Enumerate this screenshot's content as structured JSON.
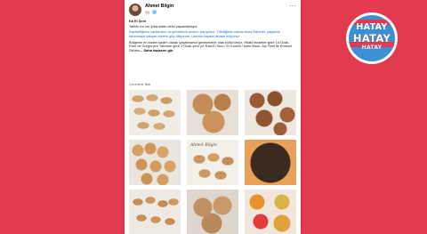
{
  "post": {
    "author": "Ahmet Bilgin",
    "time": "1g",
    "globe_icon": "globe-icon",
    "more_icon": "more-options-icon",
    "title": "Kâ El Şeni",
    "paragraphs": [
      "Tarihin en zor yıllarından birini yaşamaktayız.",
      "Kaybettiğimiz canlarımız ve şehrimizin acısını yaşıyoruz. Yitirdiğimiz canlarımıza Rahmet, yaşanda tutunmaya çalışan bizlere güç diliyorum. Umutla hayata devam ediyoruz.",
      "Bölgenin en kadim kadim olarak yaşatmamız gerekmekte olan kültürümüz; Hitabi lezzetler göre 14 Ocak, Rum ve Gregoryen Takvime göre 1 Ocak yeni yıl: Rad El Seni / El Kuzelli / kutlu olsun. Açı Seni ile Embom Sköten"
    ],
    "see_more": "... Daha fazlasını gör",
    "translate": "Çevirisine Bak"
  },
  "photos": [
    {
      "alt": "photo-1"
    },
    {
      "alt": "photo-2"
    },
    {
      "alt": "photo-3"
    },
    {
      "alt": "photo-4"
    },
    {
      "alt": "photo-5",
      "overlay": "Ahmet Bilgin"
    },
    {
      "alt": "photo-6"
    },
    {
      "alt": "photo-7"
    },
    {
      "alt": "photo-8"
    },
    {
      "alt": "photo-9"
    }
  ],
  "logo": {
    "line1": "HATAY",
    "line2": "HATAY",
    "line3": "HATAY",
    "colors": {
      "brand_red": "#e23a4f",
      "brand_blue": "#3d8fd4"
    }
  },
  "colors": {
    "background": "#e23a4f",
    "card": "#ffffff",
    "link": "#216fdb"
  }
}
